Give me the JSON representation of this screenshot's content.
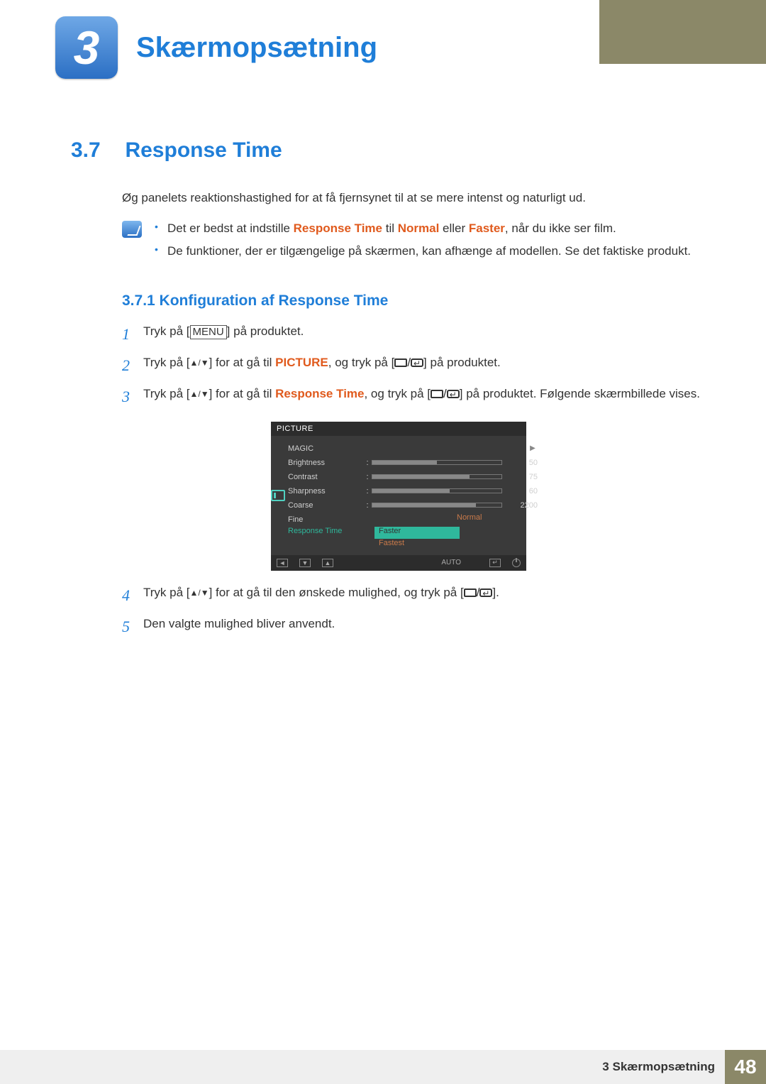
{
  "chapter": {
    "number": "3",
    "title": "Skærmopsætning"
  },
  "section": {
    "number": "3.7",
    "title": "Response Time"
  },
  "intro": "Øg panelets reaktionshastighed for at få fjernsynet til at se mere intenst og naturligt ud.",
  "notes": {
    "item1_a": "Det er bedst at indstille ",
    "item1_kw1": "Response Time",
    "item1_b": " til ",
    "item1_kw2": "Normal",
    "item1_c": " eller ",
    "item1_kw3": "Faster",
    "item1_d": ", når du ikke ser film.",
    "item2": "De funktioner, der er tilgængelige på skærmen, kan afhænge af modellen. Se det faktiske produkt."
  },
  "subheading": "3.7.1 Konfiguration af Response Time",
  "steps": {
    "s1_a": "Tryk på [",
    "s1_menu": "MENU",
    "s1_b": "] på produktet.",
    "s2_a": "Tryk på [",
    "s2_arrows": "▲/▼",
    "s2_b": "] for at gå til ",
    "s2_kw": "PICTURE",
    "s2_c": ", og tryk på [",
    "s2_d": "] på produktet.",
    "s3_a": "Tryk på [",
    "s3_arrows": "▲/▼",
    "s3_b": "] for at gå til ",
    "s3_kw": "Response Time",
    "s3_c": ", og tryk på [",
    "s3_d": "] på produktet. Følgende skærmbillede vises.",
    "s4_a": "Tryk på [",
    "s4_arrows": "▲/▼",
    "s4_b": "] for at gå til den ønskede mulighed, og tryk på [",
    "s4_c": "].",
    "s5": "Den valgte mulighed bliver anvendt."
  },
  "osd": {
    "title": "PICTURE",
    "items": {
      "magic": "MAGIC",
      "brightness": {
        "label": "Brightness",
        "value": "50",
        "fill": 50
      },
      "contrast": {
        "label": "Contrast",
        "value": "75",
        "fill": 75
      },
      "sharpness": {
        "label": "Sharpness",
        "value": "60",
        "fill": 60
      },
      "coarse": {
        "label": "Coarse",
        "value": "2200",
        "fill": 80
      },
      "fine": {
        "label": "Fine"
      },
      "response": {
        "label": "Response Time"
      }
    },
    "options": {
      "normal": "Normal",
      "faster": "Faster",
      "fastest": "Fastest"
    },
    "auto": "AUTO"
  },
  "footer": {
    "label": "3 Skærmopsætning",
    "page": "48"
  }
}
